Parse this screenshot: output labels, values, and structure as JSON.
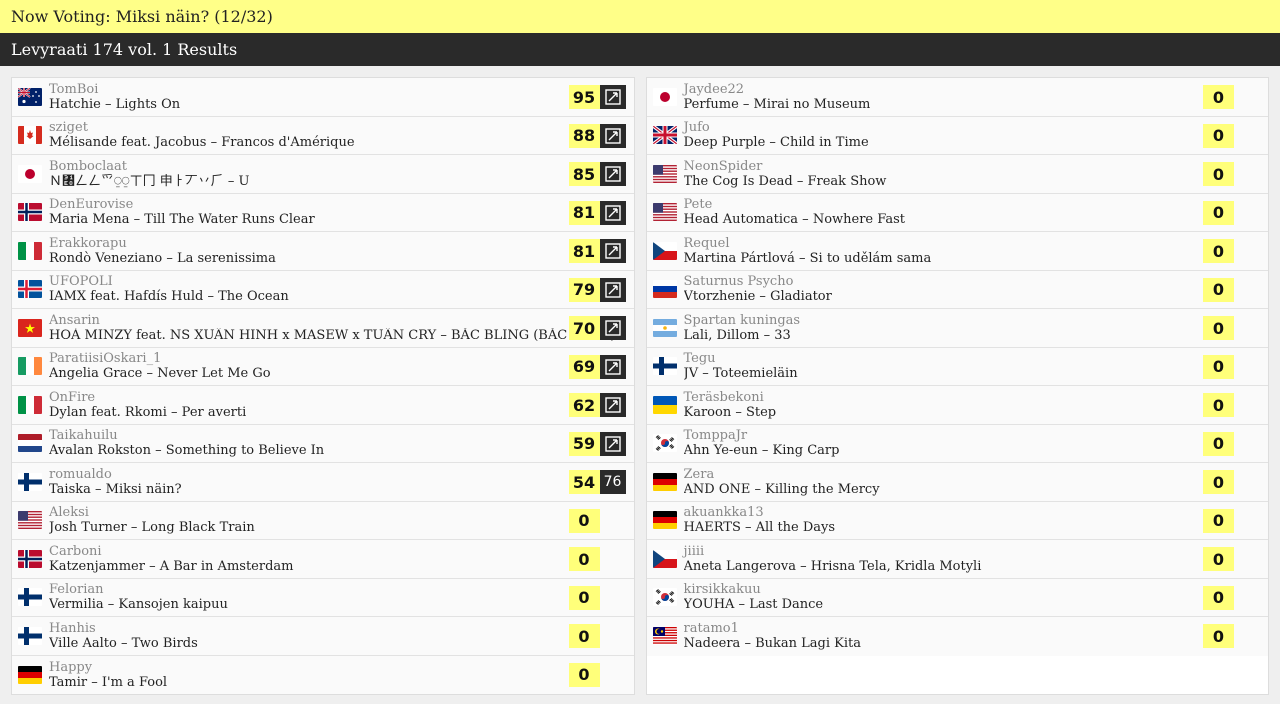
{
  "header": {
    "now_voting": "Now Voting: Miksi näin? (12/32)"
  },
  "subheader": {
    "title": "Levyraati 174 vol. 1 Results"
  },
  "left": [
    {
      "user": "TomBoi",
      "artist": "Hatchie",
      "sep": " – ",
      "title": "Lights On",
      "score": "95",
      "flag": "au",
      "status": "check"
    },
    {
      "user": "sziget",
      "artist": "Mélisande feat. Jacobus",
      "sep": " – ",
      "title": "Francos d'Amérique",
      "score": "88",
      "flag": "ca",
      "status": "check"
    },
    {
      "user": "Bomboclaat",
      "artist": "Ｎ㇨ㄥㄥ爫⍜⍜ㄒ冂 申ㅏ丆丷⺁",
      "sep": " – ",
      "title": "U",
      "score": "85",
      "flag": "jp",
      "status": "check"
    },
    {
      "user": "DenEurovise",
      "artist": "Maria Mena",
      "sep": " – ",
      "title": "Till The Water Runs Clear",
      "score": "81",
      "flag": "no",
      "status": "check"
    },
    {
      "user": "Erakkorapu",
      "artist": "Rondò Veneziano",
      "sep": " – ",
      "title": "La serenissima",
      "score": "81",
      "flag": "it",
      "status": "check"
    },
    {
      "user": "UFOPOLI",
      "artist": "IAMX feat. Hafdís Huld",
      "sep": " – ",
      "title": "The Ocean",
      "score": "79",
      "flag": "is",
      "status": "check"
    },
    {
      "user": "Ansarin",
      "artist": "HOÀ MINZY feat. NS XUÂN HINH x MASEW x TUẤN CRY",
      "sep": " – ",
      "title": "BẮC BLING (BẮC NINH)",
      "score": "70",
      "flag": "vn",
      "status": "check"
    },
    {
      "user": "ParatiisiOskari_1",
      "artist": "Angelia Grace",
      "sep": " – ",
      "title": "Never Let Me Go",
      "score": "69",
      "flag": "ie",
      "status": "check"
    },
    {
      "user": "OnFire",
      "artist": "Dylan feat. Rkomi",
      "sep": " – ",
      "title": "Per averti",
      "score": "62",
      "flag": "it",
      "status": "check"
    },
    {
      "user": "Taikahuilu",
      "artist": "Avalan Rokston",
      "sep": " – ",
      "title": "Something to Believe In",
      "score": "59",
      "flag": "nl",
      "status": "check"
    },
    {
      "user": "romualdo",
      "artist": "Taiska",
      "sep": " – ",
      "title": "Miksi näin?",
      "score": "54",
      "flag": "fi",
      "status": "points",
      "points": "76"
    },
    {
      "user": "Aleksi",
      "artist": "Josh Turner",
      "sep": " – ",
      "title": "Long Black Train",
      "score": "0",
      "flag": "us",
      "status": "none"
    },
    {
      "user": "Carboni",
      "artist": "Katzenjammer",
      "sep": " – ",
      "title": "A Bar in Amsterdam",
      "score": "0",
      "flag": "no",
      "status": "none"
    },
    {
      "user": "Felorian",
      "artist": "Vermilia",
      "sep": " – ",
      "title": "Kansojen kaipuu",
      "score": "0",
      "flag": "fi",
      "status": "none"
    },
    {
      "user": "Hanhis",
      "artist": "Ville Aalto",
      "sep": " – ",
      "title": "Two Birds",
      "score": "0",
      "flag": "fi",
      "status": "none"
    },
    {
      "user": "Happy",
      "artist": "Tamir",
      "sep": " – ",
      "title": "I'm a Fool",
      "score": "0",
      "flag": "de",
      "status": "none"
    }
  ],
  "right": [
    {
      "user": "Jaydee22",
      "artist": "Perfume",
      "sep": " – ",
      "title": "Mirai no Museum",
      "score": "0",
      "flag": "jp",
      "status": "none"
    },
    {
      "user": "Jufo",
      "artist": "Deep Purple",
      "sep": " – ",
      "title": "Child in Time",
      "score": "0",
      "flag": "gb",
      "status": "none"
    },
    {
      "user": "NeonSpider",
      "artist": "The Cog Is Dead",
      "sep": " – ",
      "title": "Freak Show",
      "score": "0",
      "flag": "us",
      "status": "none"
    },
    {
      "user": "Pete",
      "artist": "Head Automatica",
      "sep": " – ",
      "title": "Nowhere Fast",
      "score": "0",
      "flag": "us",
      "status": "none"
    },
    {
      "user": "Requel",
      "artist": "Martina Pártlová",
      "sep": " – ",
      "title": "Si to udělám sama",
      "score": "0",
      "flag": "cz",
      "status": "none"
    },
    {
      "user": "Saturnus Psycho",
      "artist": "Vtorzhenie",
      "sep": " – ",
      "title": "Gladiator",
      "score": "0",
      "flag": "ru",
      "status": "none"
    },
    {
      "user": "Spartan kuningas",
      "artist": "Lali, Dillom",
      "sep": " – ",
      "title": "33",
      "score": "0",
      "flag": "ar",
      "status": "none"
    },
    {
      "user": "Tegu",
      "artist": "JV",
      "sep": " – ",
      "title": "Toteemieläin",
      "score": "0",
      "flag": "fi",
      "status": "none"
    },
    {
      "user": "Teräsbekoni",
      "artist": "Karoon",
      "sep": " – ",
      "title": "Step",
      "score": "0",
      "flag": "ua",
      "status": "none"
    },
    {
      "user": "TomppaJr",
      "artist": "Ahn Ye-eun",
      "sep": " – ",
      "title": "King Carp",
      "score": "0",
      "flag": "kr",
      "status": "none"
    },
    {
      "user": "Zera",
      "artist": "AND ONE",
      "sep": " – ",
      "title": "Killing the Mercy",
      "score": "0",
      "flag": "de",
      "status": "none"
    },
    {
      "user": "akuankka13",
      "artist": "HAERTS",
      "sep": " – ",
      "title": "All the Days",
      "score": "0",
      "flag": "de",
      "status": "none"
    },
    {
      "user": "jiiii",
      "artist": "Aneta Langerova",
      "sep": " – ",
      "title": "Hrisna Tela, Kridla Motyli",
      "score": "0",
      "flag": "cz",
      "status": "none"
    },
    {
      "user": "kirsikkakuu",
      "artist": "YOUHA",
      "sep": " – ",
      "title": "Last Dance",
      "score": "0",
      "flag": "kr",
      "status": "none"
    },
    {
      "user": "ratamo1",
      "artist": "Nadeera",
      "sep": " – ",
      "title": "Bukan Lagi Kita",
      "score": "0",
      "flag": "my",
      "status": "none"
    }
  ],
  "colors": {
    "accent_yellow": "#ffff88",
    "score_yellow": "#ffff7a",
    "dark": "#2a2a2a"
  }
}
